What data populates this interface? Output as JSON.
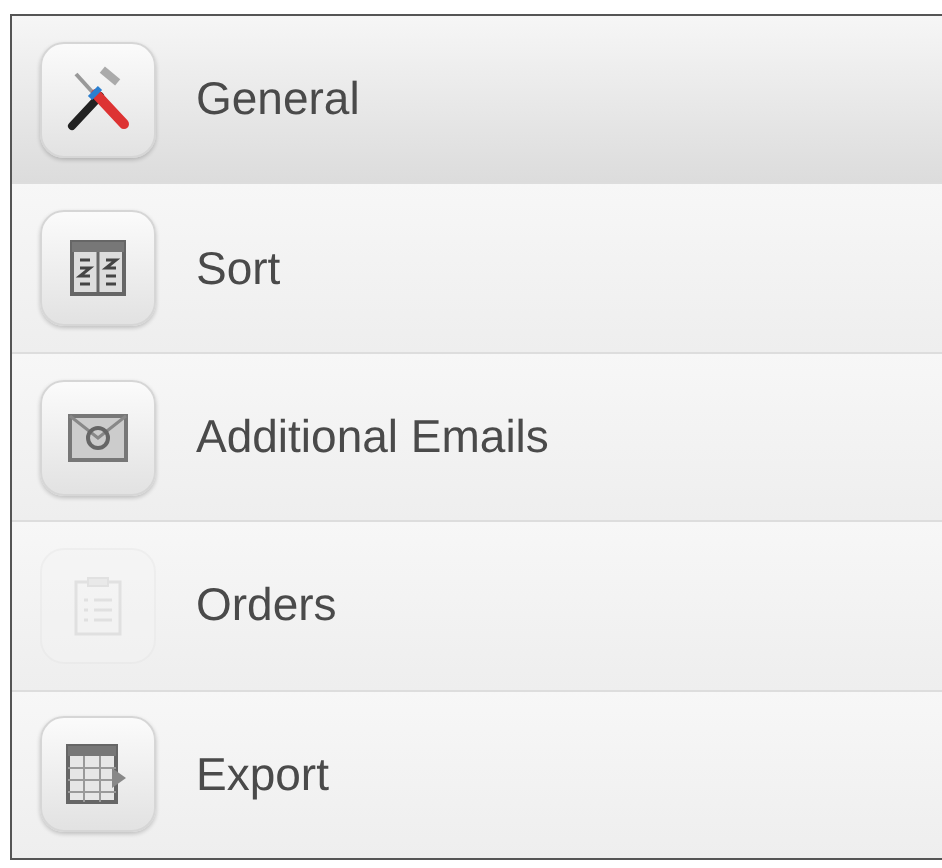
{
  "menu": [
    {
      "label": "General",
      "selected": true,
      "disabled": false
    },
    {
      "label": "Sort",
      "selected": false,
      "disabled": false
    },
    {
      "label": "Additional Emails",
      "selected": false,
      "disabled": false
    },
    {
      "label": "Orders",
      "selected": false,
      "disabled": true
    },
    {
      "label": "Export",
      "selected": false,
      "disabled": false
    }
  ]
}
